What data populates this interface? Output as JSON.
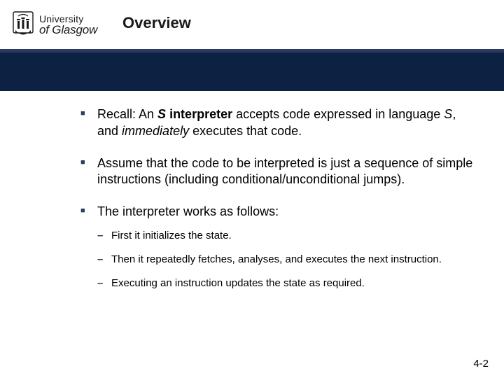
{
  "logo": {
    "uni": "University",
    "of_glasgow": "of Glasgow"
  },
  "title": "Overview",
  "bullets": [
    {
      "segments": [
        {
          "t": "Recall: An "
        },
        {
          "t": "S",
          "cls": "em-bi"
        },
        {
          "t": " interpreter",
          "cls": "em-b"
        },
        {
          "t": " accepts code expressed in language "
        },
        {
          "t": "S",
          "cls": "em-i"
        },
        {
          "t": ", and "
        },
        {
          "t": "immediately",
          "cls": "em-i"
        },
        {
          "t": " executes that code."
        }
      ]
    },
    {
      "segments": [
        {
          "t": "Assume that the code to be interpreted is just a sequence of simple instructions (including conditional/unconditional jumps)."
        }
      ]
    },
    {
      "segments": [
        {
          "t": "The interpreter works as follows:"
        }
      ],
      "sub": [
        {
          "segments": [
            {
              "t": "First it initializes the state."
            }
          ]
        },
        {
          "segments": [
            {
              "t": "Then it repeatedly fetches, analyses, and executes the next instruction."
            }
          ]
        },
        {
          "segments": [
            {
              "t": "Executing an instruction updates the state as required."
            }
          ]
        }
      ]
    }
  ],
  "page_number": "4-2",
  "colors": {
    "nav_band": "#0d2142",
    "accent": "#2c3a60"
  }
}
